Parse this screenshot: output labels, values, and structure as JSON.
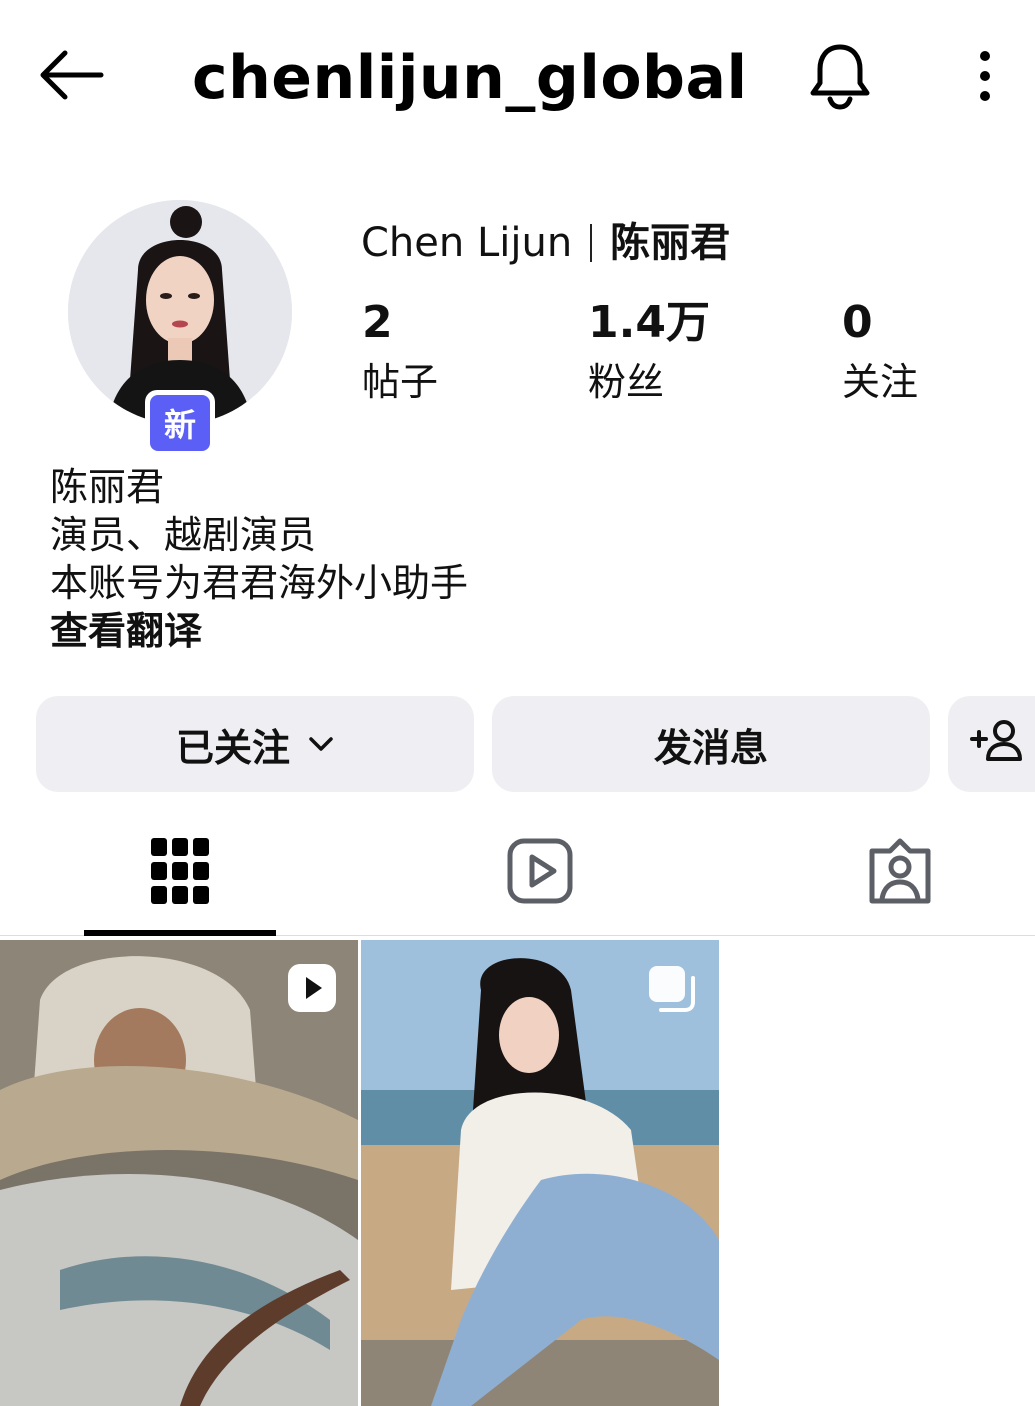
{
  "header": {
    "username": "chenlijun_global",
    "icons": {
      "back": "arrow-left-icon",
      "notifications": "bell-icon",
      "more": "more-vertical-icon"
    }
  },
  "profile": {
    "new_badge": "新",
    "full_name_latin": "Chen Lijun",
    "full_name_cn": "陈丽君",
    "stats": [
      {
        "value": "2",
        "label": "帖子"
      },
      {
        "value": "1.4万",
        "label": "粉丝"
      },
      {
        "value": "0",
        "label": "关注"
      }
    ],
    "bio": {
      "line1": "陈丽君",
      "line2": "演员、越剧演员",
      "line3": "本账号为君君海外小助手",
      "translate": "查看翻译"
    }
  },
  "actions": {
    "following_label": "已关注",
    "message_label": "发消息",
    "add_user_icon": "person-add-icon"
  },
  "tabs": [
    {
      "name": "grid",
      "icon": "grid-icon",
      "active": true
    },
    {
      "name": "reels",
      "icon": "reels-icon",
      "active": false
    },
    {
      "name": "tagged",
      "icon": "tagged-person-icon",
      "active": false
    }
  ],
  "posts": [
    {
      "type": "reel",
      "badge_icon": "play-icon"
    },
    {
      "type": "carousel",
      "badge_icon": "carousel-icon"
    }
  ],
  "colors": {
    "accent_badge": "#5b5ff5",
    "button_bg": "#efeff3",
    "text": "#111111"
  }
}
